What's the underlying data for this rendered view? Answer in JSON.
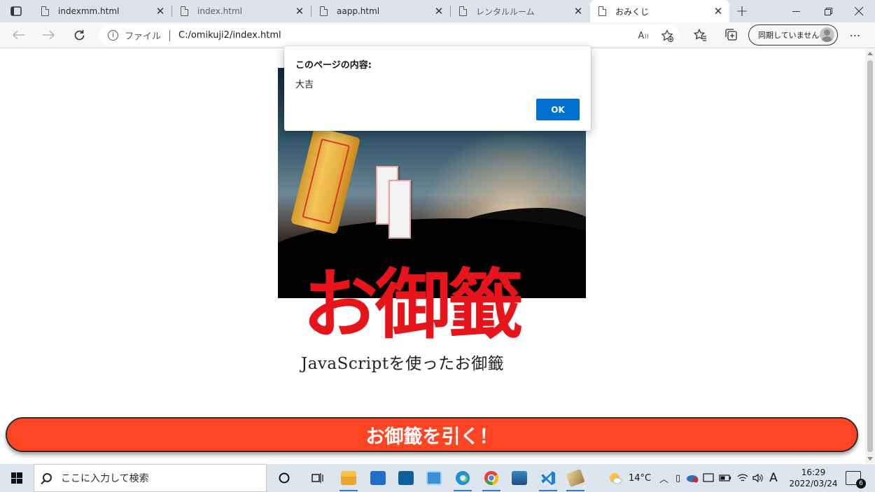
{
  "browser": {
    "tabs": [
      {
        "title": "indexmm.html"
      },
      {
        "title": "index.html"
      },
      {
        "title": "aapp.html"
      },
      {
        "title": "レンタルルーム"
      },
      {
        "title": "おみくじ"
      }
    ],
    "address": {
      "protocol_label": "ファイル",
      "url": "C:/omikuji2/index.html"
    },
    "profile_label": "同期していません"
  },
  "page": {
    "hero_title": "お御籤",
    "subtitle": "JavaScriptを使ったお御籤",
    "draw_button": "お御籤を引く！"
  },
  "dialog": {
    "title": "このページの内容:",
    "message": "大吉",
    "ok_label": "OK"
  },
  "taskbar": {
    "search_placeholder": "ここに入力して検索",
    "weather": "14°C",
    "ime": "A",
    "time": "16:29",
    "date": "2022/03/24",
    "notification_count": "6"
  },
  "colors": {
    "accent_button": "#fd4423",
    "dialog_ok": "#0071d0",
    "title_red": "#e8141c"
  }
}
